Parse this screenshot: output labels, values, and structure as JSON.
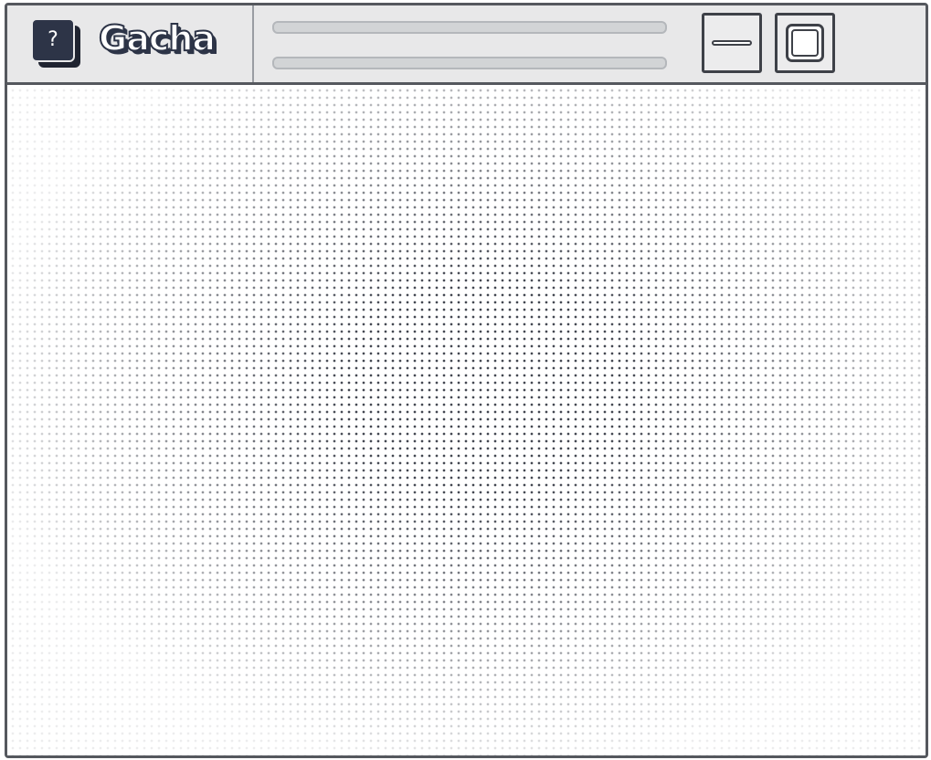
{
  "window": {
    "title": "Gacha",
    "app_icon_glyph": "?",
    "app_icon_name": "help-app-icon",
    "controls": {
      "minimize_icon": "minimize-icon",
      "maximize_icon": "maximize-icon"
    }
  },
  "colors": {
    "frame": "#55585e",
    "titlebar": "#e8e8e9",
    "icon_fill": "#2d3447",
    "placeholder_bar": "#d2d4d6",
    "dot_pattern": "#444852"
  }
}
